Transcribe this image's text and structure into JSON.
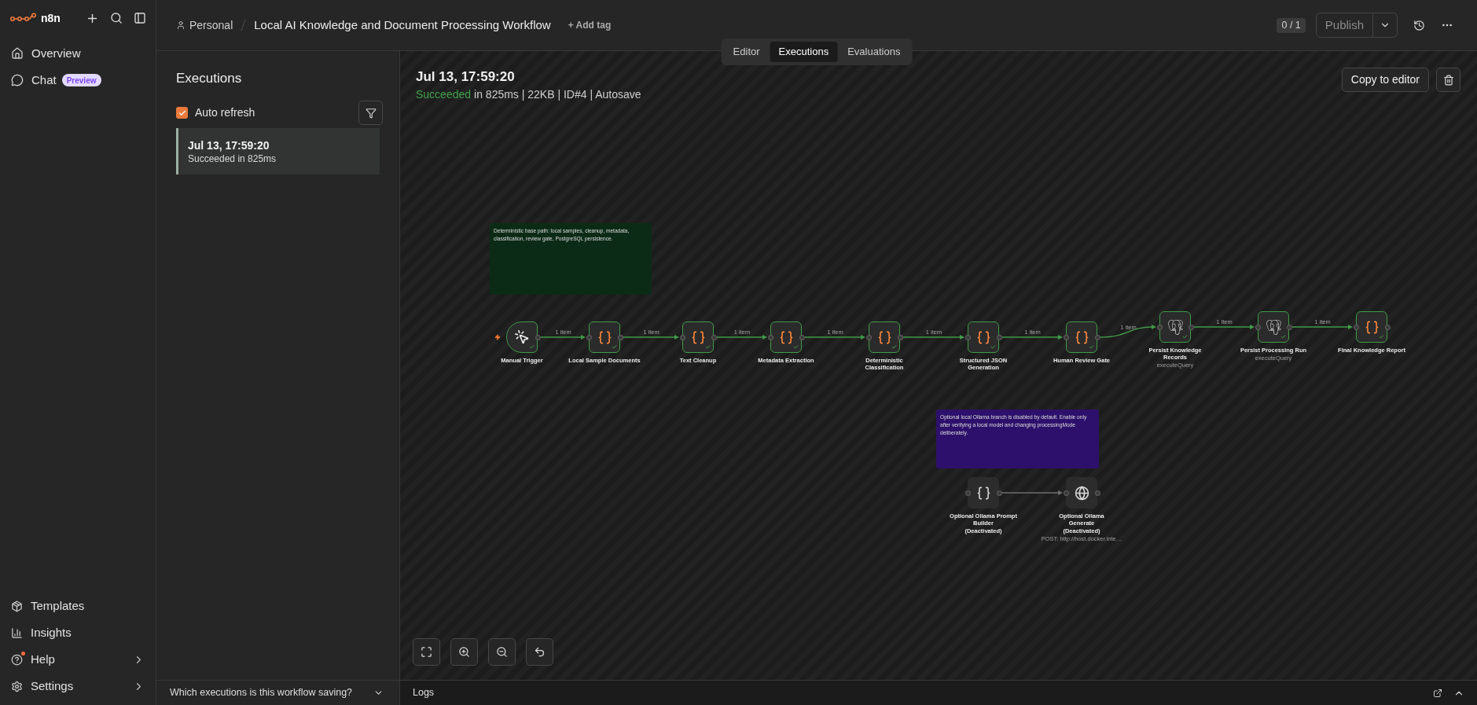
{
  "sidebar": {
    "brand": "n8n",
    "nav": [
      {
        "label": "Overview"
      },
      {
        "label": "Chat",
        "badge": "Preview"
      }
    ],
    "footer": [
      {
        "label": "Templates",
        "submenu": false,
        "notification": false
      },
      {
        "label": "Insights",
        "submenu": false,
        "notification": false
      },
      {
        "label": "Help",
        "submenu": true,
        "notification": true
      },
      {
        "label": "Settings",
        "submenu": true,
        "notification": false
      }
    ]
  },
  "header": {
    "project": "Personal",
    "title": "Local AI Knowledge and Document Processing Workflow",
    "add_tag": "+ Add tag",
    "counter": "0 / 1",
    "publish": {
      "label": "Publish",
      "disabled": true
    }
  },
  "view_tabs": [
    {
      "label": "Editor",
      "selected": false
    },
    {
      "label": "Executions",
      "selected": true
    },
    {
      "label": "Evaluations",
      "selected": false
    }
  ],
  "executions_panel": {
    "title": "Executions",
    "auto_refresh": {
      "label": "Auto refresh",
      "checked": true
    },
    "items": [
      {
        "time": "Jul 13, 17:59:20",
        "status": "Succeeded in 825ms",
        "selected": true
      }
    ],
    "footer": "Which executions is this workflow saving?"
  },
  "execution_detail": {
    "time": "Jul 13, 17:59:20",
    "status": {
      "label": "Succeeded",
      "kind": "success"
    },
    "summary": "in 825ms | 22KB | ID#4 | Autosave",
    "copy_button": "Copy to editor"
  },
  "canvas": {
    "notes": [
      {
        "text": "Deterministic base path: local samples, cleanup, metadata, classification, review gate, PostgreSQL persistence.",
        "color": "#0c2b17"
      },
      {
        "text": "Optional local Ollama branch is disabled by default. Enable only after verifying a local model and changing processingMode deliberately.",
        "color": "#2d106c"
      }
    ],
    "main_path": [
      {
        "kind": "trigger",
        "label": "Manual Trigger",
        "deactivated": false,
        "edge_label": "1 item"
      },
      {
        "kind": "code",
        "label": "Local Sample Documents",
        "deactivated": false,
        "edge_label": "1 item"
      },
      {
        "kind": "code",
        "label": "Text Cleanup",
        "deactivated": false,
        "edge_label": "1 item"
      },
      {
        "kind": "code",
        "label": "Metadata Extraction",
        "deactivated": false,
        "edge_label": "1 item"
      },
      {
        "kind": "code",
        "label": "Deterministic Classification",
        "deactivated": false,
        "edge_label": "1 item"
      },
      {
        "kind": "code",
        "label": "Structured JSON Generation",
        "deactivated": false,
        "edge_label": "1 item"
      },
      {
        "kind": "code",
        "label": "Human Review Gate",
        "deactivated": false,
        "edge_label": "1 item"
      },
      {
        "kind": "postgres",
        "label": "Persist Knowledge Records",
        "subtitle": "executeQuery",
        "deactivated": false,
        "edge_label": "1 item"
      },
      {
        "kind": "postgres",
        "label": "Persist Processing Run",
        "subtitle": "executeQuery",
        "deactivated": false,
        "edge_label": "1 item"
      },
      {
        "kind": "code",
        "label": "Final Knowledge Report",
        "deactivated": false
      }
    ],
    "optional_branch": [
      {
        "kind": "code",
        "label": "Optional Ollama Prompt Builder",
        "deactivated": true,
        "status_note": "(Deactivated)"
      },
      {
        "kind": "http",
        "label": "Optional Ollama Generate",
        "deactivated": true,
        "status_note": "(Deactivated)",
        "subtitle": "POST: http://host.docker.inte…"
      }
    ]
  },
  "logs_bar": {
    "label": "Logs"
  }
}
